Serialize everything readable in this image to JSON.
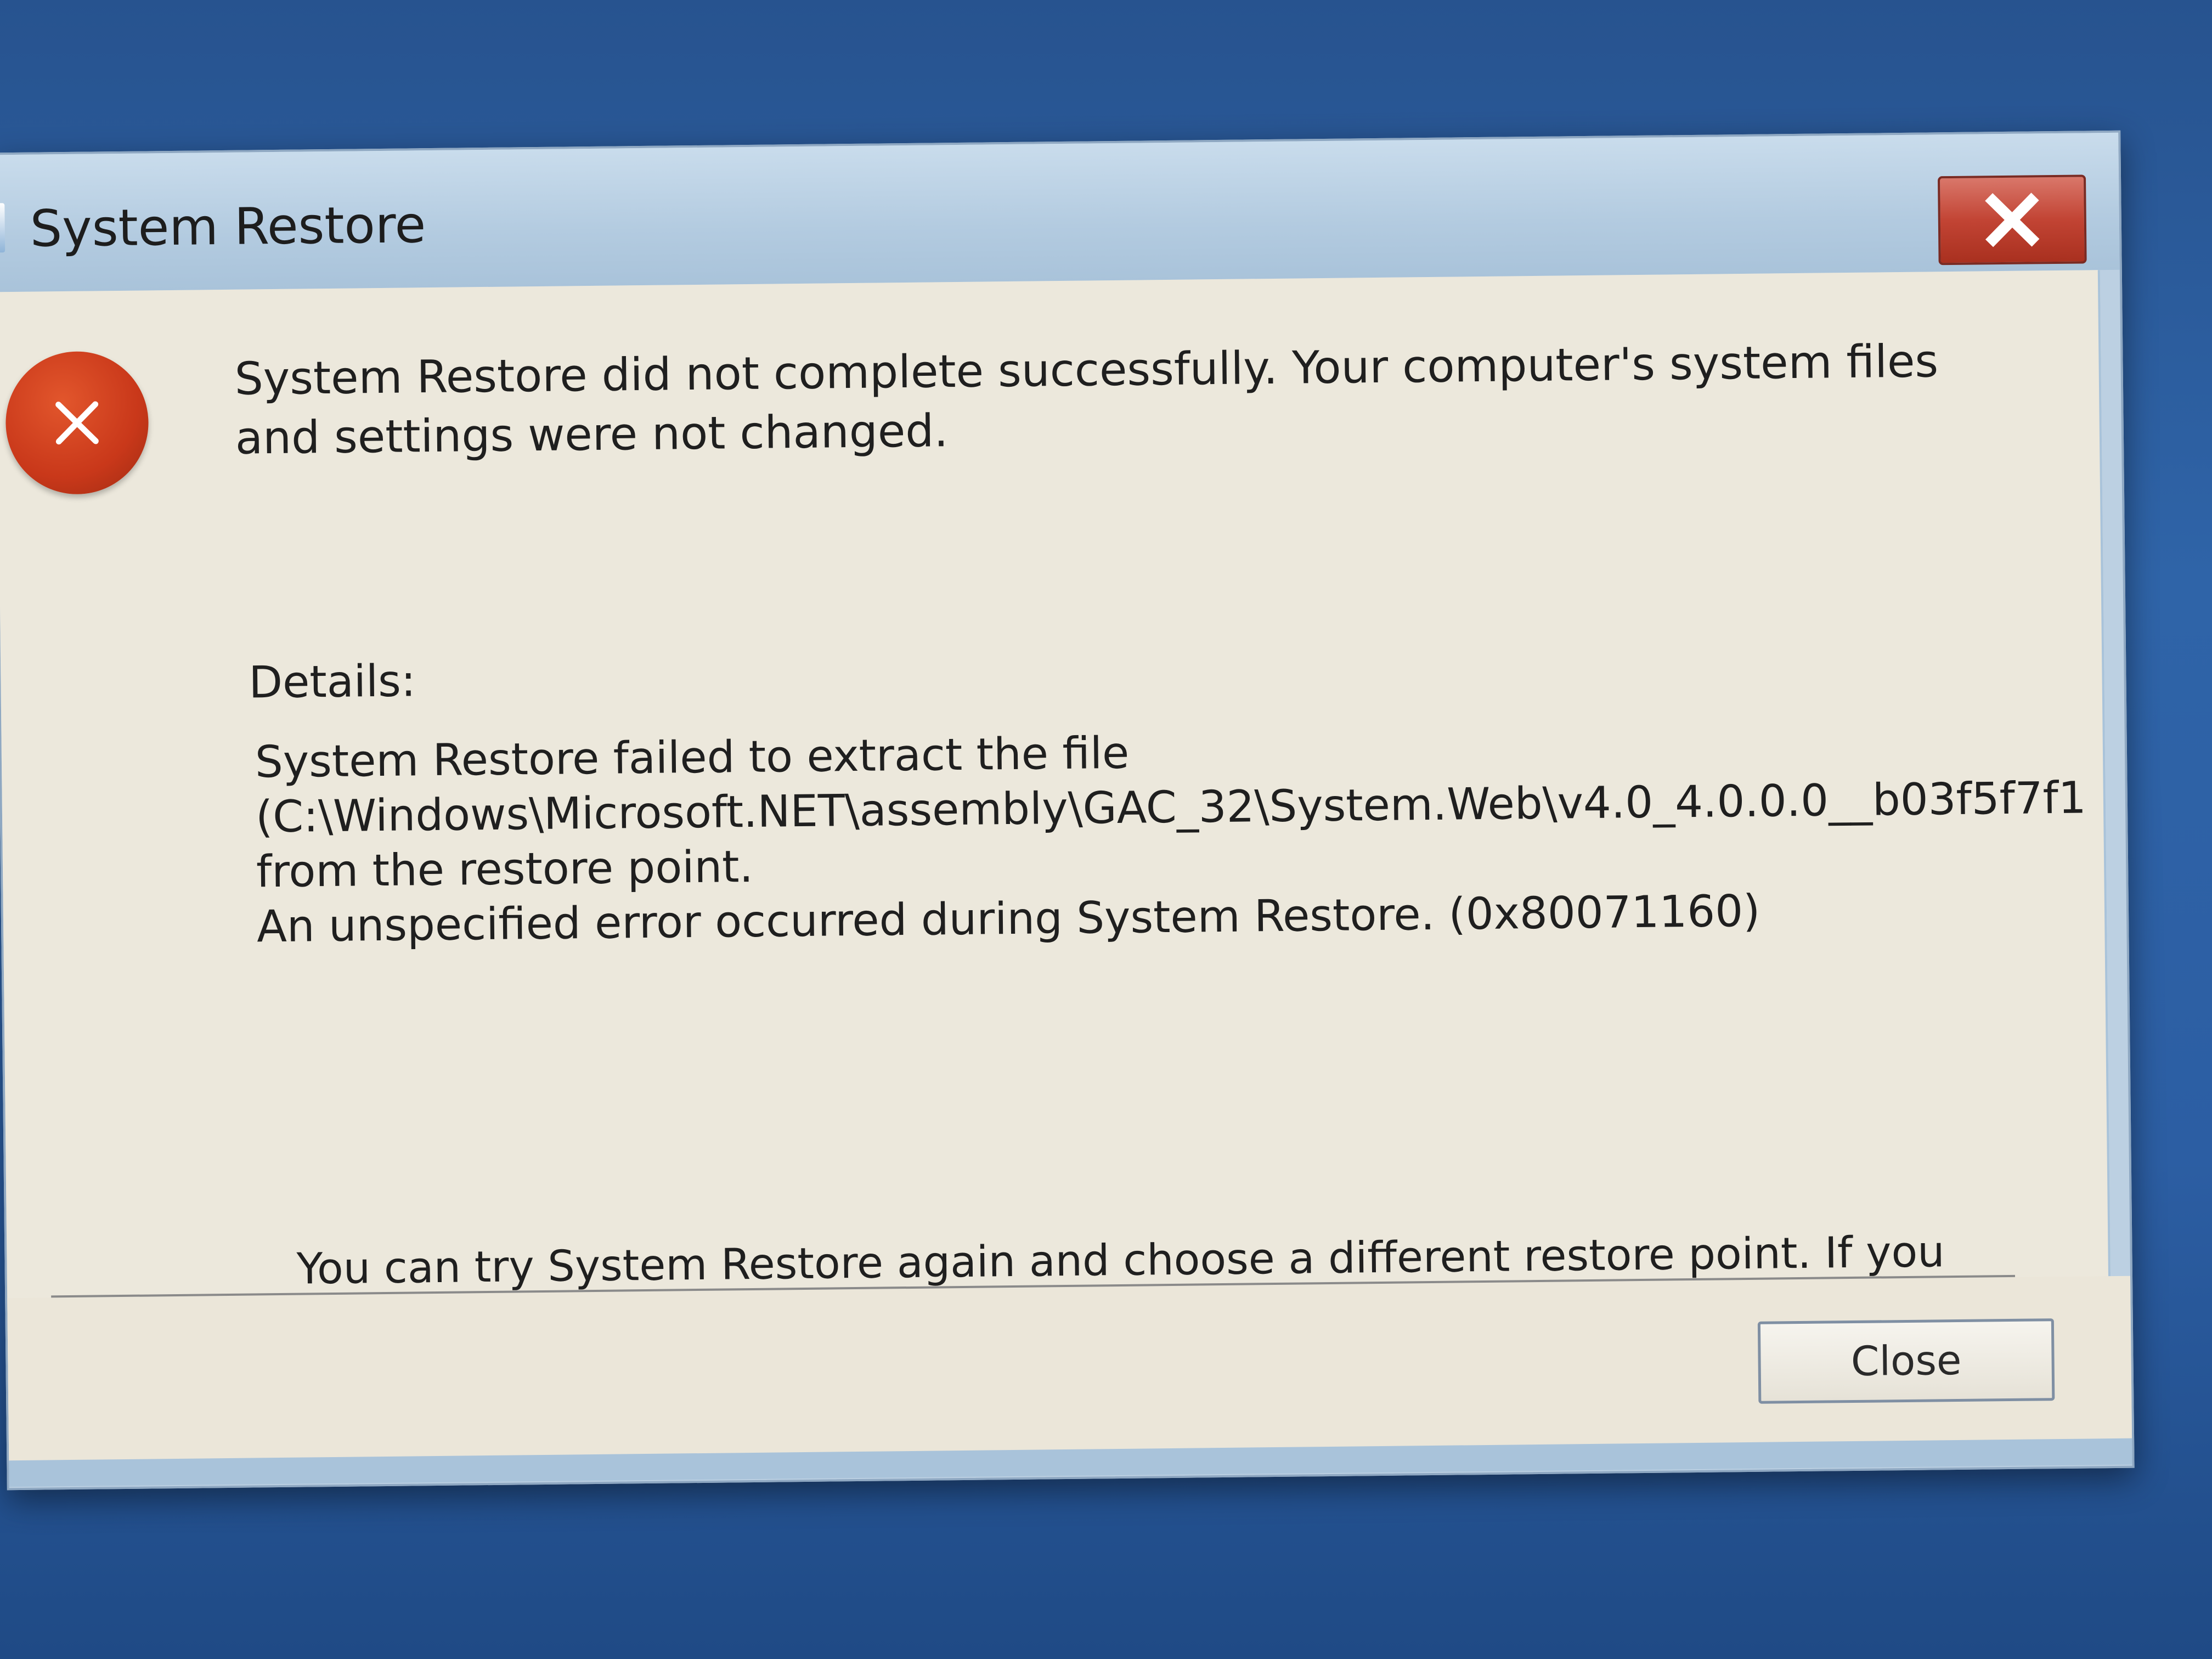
{
  "window": {
    "title": "System Restore",
    "title_icon": "system-restore-icon",
    "close_icon": "close-icon"
  },
  "message": {
    "icon": "error-icon",
    "headline": "System Restore did not complete successfully. Your computer's system files and settings were not changed.",
    "details_label": "Details:",
    "details_lines": [
      "System Restore failed to extract the file",
      "(C:\\Windows\\Microsoft.NET\\assembly\\GAC_32\\System.Web\\v4.0_4.0.0.0__b03f5f7f1",
      "from the restore point.",
      "An unspecified error occurred during System Restore. (0x80071160)"
    ],
    "advice": "You can try System Restore again and choose a different restore point. If you continue to see this error, you can try an advanced recovery method."
  },
  "buttons": {
    "close_label": "Close"
  },
  "colors": {
    "error_red": "#c9381a",
    "close_x_red": "#c24434",
    "dialog_bg": "#ece8dc",
    "frame": "#bcd0e2",
    "desktop": "#2d5fa3"
  }
}
